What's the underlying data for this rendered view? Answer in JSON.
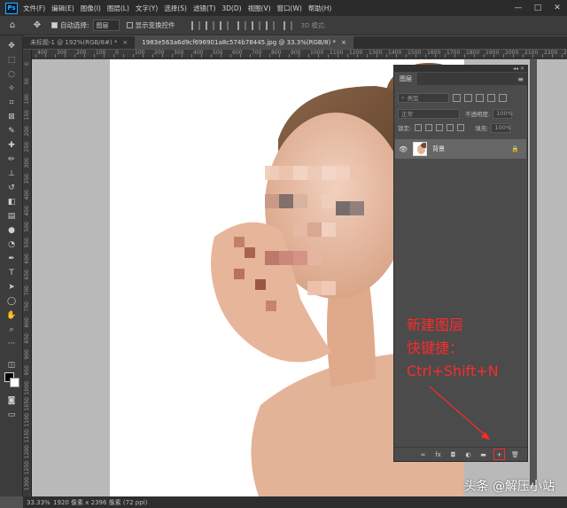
{
  "app": {
    "logo_text": "Ps",
    "menu": [
      "文件(F)",
      "编辑(E)",
      "图像(I)",
      "图层(L)",
      "文字(Y)",
      "选择(S)",
      "滤镜(T)",
      "3D(D)",
      "视图(V)",
      "窗口(W)",
      "帮助(H)"
    ],
    "window_controls": [
      "—",
      "□",
      "✕"
    ]
  },
  "options": {
    "auto_select_label": "自动选择:",
    "auto_select_target": "图层",
    "show_transform_label": "显示变换控件",
    "mode_3d_label": "3D 模式:"
  },
  "tabs": [
    {
      "label": "未标题-1 @ 192%(RGB/8#) *",
      "close": "×"
    },
    {
      "label": "1983e563a6d9cf696901a8c574b78445.jpg @ 33.3%(RGB/8) *",
      "close": "×"
    }
  ],
  "rulers": {
    "top": [
      "400",
      "350",
      "300",
      "250",
      "200",
      "150",
      "100",
      "50",
      "0",
      "50",
      "100",
      "150",
      "200",
      "250",
      "300",
      "350",
      "400",
      "450",
      "500",
      "550",
      "600",
      "650",
      "700",
      "750",
      "800",
      "850",
      "900",
      "950",
      "1000",
      "1050",
      "1100",
      "1150",
      "1200",
      "1250",
      "1300",
      "1350",
      "1400",
      "1450",
      "1500",
      "1550",
      "1600",
      "1650",
      "1700",
      "1750",
      "1800",
      "1850",
      "1900",
      "1950",
      "2000",
      "2050",
      "2100",
      "2150",
      "2200",
      "2250",
      "2300"
    ],
    "left": [
      "0",
      "50",
      "100",
      "150",
      "200",
      "250",
      "300",
      "350",
      "400",
      "450",
      "500",
      "550",
      "600",
      "650",
      "700",
      "750",
      "800",
      "850",
      "900",
      "950",
      "1000",
      "1050",
      "1100",
      "1150",
      "1200",
      "1250",
      "1300",
      "1350"
    ]
  },
  "layers_panel": {
    "collapse_glyph": "◂◂ ✕",
    "title": "图层",
    "menu_glyph": "≡",
    "filter_label": "类型",
    "blend_mode": "正常",
    "opacity_label": "不透明度:",
    "opacity_value": "100%",
    "lock_label": "锁定:",
    "fill_label": "填充:",
    "fill_value": "100%",
    "layer": {
      "name": "背景",
      "eye": "👁",
      "lock": "🔒"
    },
    "annotation": [
      "新建图层",
      "快键捷：",
      "Ctrl+Shift+N"
    ],
    "bottom_icons": [
      "∞",
      "fx",
      "◘",
      "◐",
      "▬",
      "+",
      "🗑"
    ]
  },
  "status": {
    "zoom": "33.33%",
    "doc_info": "1920 像素 x 2396 像素 (72 ppi)"
  },
  "watermark": "头条 @解压小站",
  "colors": {
    "accent_red": "#ff2a2a",
    "menubar": "#2b2b2b",
    "panel": "#4b4b4b"
  }
}
